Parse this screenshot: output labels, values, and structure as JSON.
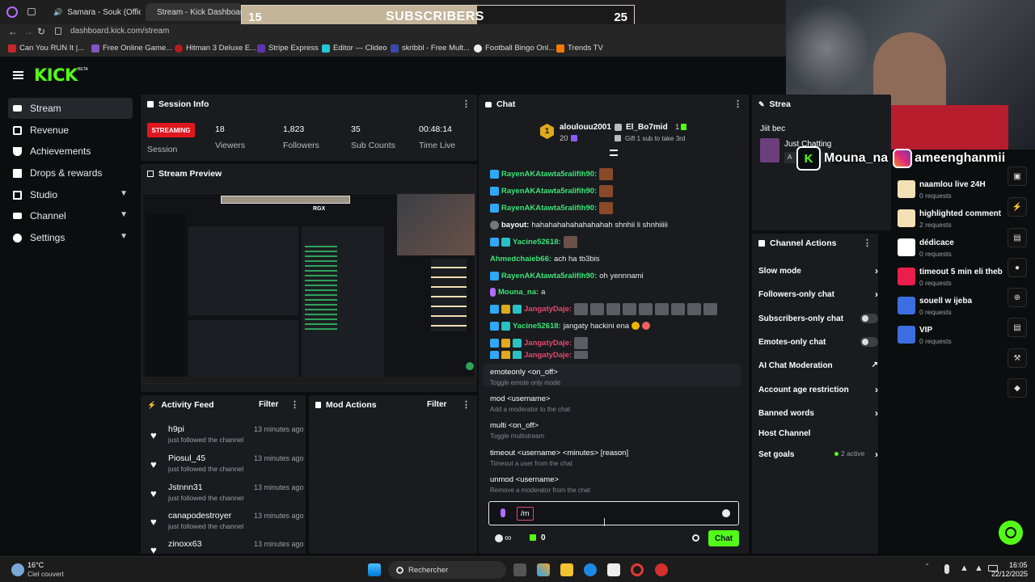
{
  "browser": {
    "tabs": [
      {
        "label": "Samara - Souk (Offici"
      },
      {
        "label": "Stream - Kick Dashboard"
      }
    ],
    "url": "dashboard.kick.com/stream",
    "bookmarks": [
      "Can You RUN It |...",
      "Free Online Game...",
      "Hitman 3 Deluxe E...",
      "Stripe Express",
      "Editor — Clideo",
      "skribbl - Free Mult...",
      "Football Bingo Onl...",
      "Trends TV"
    ]
  },
  "overlay_goal": {
    "current": "15",
    "label": "SUBSCRIBERS",
    "target": "25",
    "progress_fraction": 0.6
  },
  "overlay_names": {
    "left": "Mouna_na",
    "right": "ameenghanmii"
  },
  "kick": {
    "logo": "KICK",
    "logo_beta": "BETA"
  },
  "sidebar": {
    "items": [
      {
        "label": "Stream",
        "icon": "camera-icon"
      },
      {
        "label": "Revenue",
        "icon": "coin-icon"
      },
      {
        "label": "Achievements",
        "icon": "trophy-icon"
      },
      {
        "label": "Drops & rewards",
        "icon": "gift-icon"
      },
      {
        "label": "Studio",
        "icon": "grid-icon"
      },
      {
        "label": "Channel",
        "icon": "tv-icon"
      },
      {
        "label": "Settings",
        "icon": "gear-icon"
      }
    ]
  },
  "session": {
    "title": "Session Info",
    "status_badge": "STREAMING",
    "status_label": "Session",
    "stats": [
      {
        "value": "18",
        "label": "Viewers"
      },
      {
        "value": "1,823",
        "label": "Followers"
      },
      {
        "value": "35",
        "label": "Sub Counts"
      },
      {
        "value": "00:48:14",
        "label": "Time Live"
      }
    ]
  },
  "preview": {
    "title": "Stream Preview",
    "inner_overlay": "RGX"
  },
  "activity": {
    "title": "Activity Feed",
    "filter": "Filter",
    "items": [
      {
        "name": "h9pi",
        "action": "just followed the channel",
        "time": "13 minutes ago"
      },
      {
        "name": "Piosul_45",
        "action": "just followed the channel",
        "time": "13 minutes ago"
      },
      {
        "name": "Jstnnn31",
        "action": "just followed the channel",
        "time": "13 minutes ago"
      },
      {
        "name": "canapodestroyer",
        "action": "just followed the channel",
        "time": "13 minutes ago"
      },
      {
        "name": "zinoxx63",
        "action": "",
        "time": "13 minutes ago"
      }
    ]
  },
  "mod_actions": {
    "title": "Mod Actions",
    "filter": "Filter"
  },
  "chat": {
    "title": "Chat",
    "gifter_top": {
      "rank": "1",
      "name": "aloulouu2001",
      "count": "20"
    },
    "gifter_second": {
      "name": "El_Bo7mid",
      "count": "1",
      "hint": "Gift 1 sub to take 3rd"
    },
    "messages": [
      {
        "user": "RayenAKAtawta5ralifih90:",
        "text": "",
        "color": "#3be477"
      },
      {
        "user": "RayenAKAtawta5ralifih90:",
        "text": "",
        "color": "#3be477"
      },
      {
        "user": "RayenAKAtawta5ralifih90:",
        "text": "",
        "color": "#3be477"
      },
      {
        "user": "bayout:",
        "text": "hahahahahahahahahah shnhii li shnhiiiii",
        "color": "#ffffff"
      },
      {
        "user": "Yacine52618:",
        "text": "",
        "color": "#3be477"
      },
      {
        "user": "Ahmedchaieb66:",
        "text": "ach ha tb3bis",
        "color": "#3be477"
      },
      {
        "user": "RayenAKAtawta5ralifih90:",
        "text": "oh yennnami",
        "color": "#3be477"
      },
      {
        "user": "Mouna_na:",
        "text": "a",
        "color": "#3be477"
      },
      {
        "user": "JangatyDaje:",
        "text": "",
        "color": "#e34a6f"
      },
      {
        "user": "Yacine52618:",
        "text": "jangaty hackini ena",
        "color": "#3be477"
      },
      {
        "user": "JangatyDaje:",
        "text": "",
        "color": "#e34a6f"
      },
      {
        "user": "JangatyDaje:",
        "text": "",
        "color": "#e34a6f"
      }
    ],
    "commands": [
      {
        "cmd": "emoteonly <on_off>",
        "desc": "Toggle emote only mode"
      },
      {
        "cmd": "mod <username>",
        "desc": "Add a moderator to the chat"
      },
      {
        "cmd": "multi <on_off>",
        "desc": "Toggle multistream"
      },
      {
        "cmd": "timeout <username> <minutes> [reason]",
        "desc": "Timeout a user from the chat"
      },
      {
        "cmd": "unmod <username>",
        "desc": "Remove a moderator from the chat"
      }
    ],
    "input_value": "/m",
    "points": "0",
    "send": "Chat"
  },
  "stream_panel": {
    "title": "Strea",
    "category_hint": "Jiit bec",
    "category": "Just Chatting",
    "tag": "A"
  },
  "channel_actions": {
    "title": "Channel Actions",
    "items": [
      {
        "label": "Slow mode",
        "kind": "arrow"
      },
      {
        "label": "Followers-only chat",
        "kind": "arrow"
      },
      {
        "label": "Subscribers-only chat",
        "kind": "toggle"
      },
      {
        "label": "Emotes-only chat",
        "kind": "toggle"
      },
      {
        "label": "AI Chat Moderation",
        "kind": "external"
      },
      {
        "label": "Account age restriction",
        "kind": "arrow"
      },
      {
        "label": "Banned words",
        "kind": "arrow"
      },
      {
        "label": "Host Channel",
        "kind": "none"
      },
      {
        "label": "Set goals",
        "kind": "arrow",
        "extra": "2 active"
      }
    ]
  },
  "rewards": [
    {
      "title": "naamlou live 24H",
      "sub": "0 requests",
      "color": "#f3e0b5"
    },
    {
      "title": "highlighted comment",
      "sub": "2 requests",
      "color": "#f3e0b5"
    },
    {
      "title": "dédicace",
      "sub": "0 requests",
      "color": "#ffffff"
    },
    {
      "title": "timeout 5 min eli theb",
      "sub": "0 requests",
      "color": "#e91e4c"
    },
    {
      "title": "souell w ijeba",
      "sub": "0 requests",
      "color": "#3b6ee0"
    },
    {
      "title": "VIP",
      "sub": "0 requests",
      "color": "#3b6ee0"
    }
  ],
  "taskbar": {
    "weather_temp": "16°C",
    "weather_desc": "Ciel couvert",
    "search": "Rechercher",
    "time": "16:05",
    "date": "22/12/2025"
  }
}
